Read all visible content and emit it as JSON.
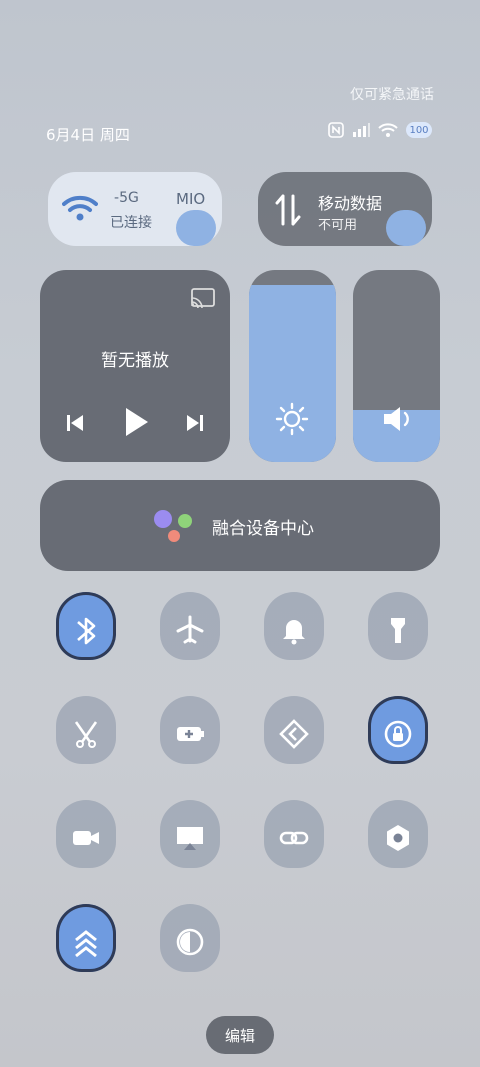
{
  "status": {
    "emergency_text": "仅可紧急通话",
    "battery": "100"
  },
  "date_line": "6月4日 周四",
  "wifi_tile": {
    "band": "5G",
    "state": "已连接",
    "ssid_fragment": "MIO"
  },
  "data_tile": {
    "title": "移动数据",
    "state": "不可用"
  },
  "media": {
    "title": "暂无播放"
  },
  "sliders": {
    "brightness_level": 0.92,
    "volume_level": 0.27
  },
  "hub": {
    "label": "融合设备中心"
  },
  "toggles": [
    {
      "icon": "bluetooth-icon",
      "active": true
    },
    {
      "icon": "airplane-icon",
      "active": false
    },
    {
      "icon": "bell-icon",
      "active": false
    },
    {
      "icon": "flashlight-icon",
      "active": false
    },
    {
      "icon": "screenshot-icon",
      "active": false
    },
    {
      "icon": "battery-saver-icon",
      "active": false
    },
    {
      "icon": "nfc-shortcut-icon",
      "active": false
    },
    {
      "icon": "rotation-lock-icon",
      "active": true
    },
    {
      "icon": "screen-record-icon",
      "active": false
    },
    {
      "icon": "screen-cast-icon",
      "active": false
    },
    {
      "icon": "hotspot-link-icon",
      "active": false
    },
    {
      "icon": "settings-hex-icon",
      "active": false
    },
    {
      "icon": "collapse-up-icon",
      "active": true
    },
    {
      "icon": "dark-mode-icon",
      "active": false
    }
  ],
  "edit_label": "编辑",
  "colors": {
    "active_tile": "#6f9be0",
    "inactive_tile": "#9aa3b2",
    "slider_fill": "#8fb2e3"
  }
}
